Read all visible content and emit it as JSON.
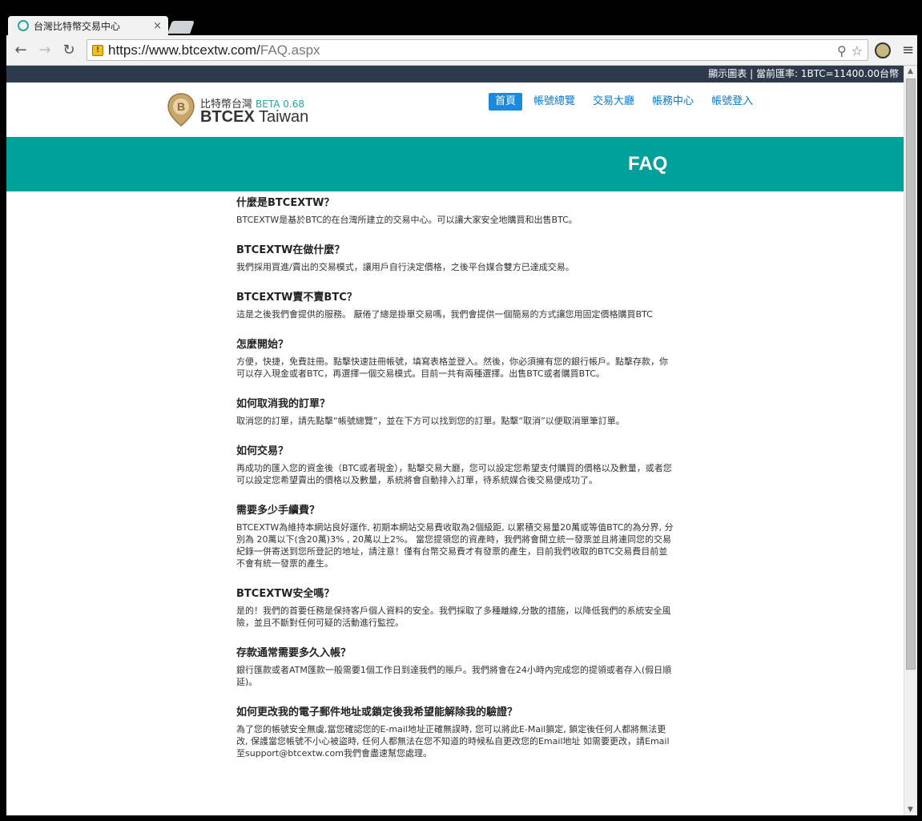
{
  "browser": {
    "tab_title": "台灣比特幣交易中心",
    "tab_close": "×",
    "url_host": "https://www.btcextw.com/",
    "url_path": "FAQ.aspx"
  },
  "topbar": {
    "text": "顯示圖表 | 當前匯率: 1BTC=11400.00台幣"
  },
  "logo": {
    "cn": "比特幣台灣",
    "beta": "BETA 0.68",
    "en_bold": "BTCEX",
    "en_rest": " Taiwan"
  },
  "nav": {
    "items": [
      "首頁",
      "帳號總覽",
      "交易大廳",
      "帳務中心",
      "帳號登入"
    ]
  },
  "hero": {
    "title": "FAQ"
  },
  "faq": [
    {
      "q": "什麼是BTCEXTW？",
      "a": "BTCEXTW是基於BTC的在台灣所建立的交易中心。可以讓大家安全地購買和出售BTC。"
    },
    {
      "q": "BTCEXTW在做什麼？",
      "a": "我們採用買進/賣出的交易模式，讓用戶自行決定價格，之後平台媒合雙方已達成交易。"
    },
    {
      "q": "BTCEXTW賣不賣BTC？",
      "a": "這是之後我們會提供的服務。 厭倦了總是掛單交易嗎，我們會提供一個簡易的方式讓您用固定價格購買BTC"
    },
    {
      "q": "怎麼開始？",
      "a": "方便，快捷，免費註冊。點擊快速註冊帳號，填寫表格並登入。然後，你必須擁有您的銀行帳戶。點擊存款，你可以存入現金或者BTC，再選擇一個交易模式。目前一共有兩種選擇。出售BTC或者購買BTC。"
    },
    {
      "q": "如何取消我的訂單？",
      "a": "取消您的訂單，請先點擊“帳號總覽”，並在下方可以找到您的訂單。點擊“取消”以便取消單筆訂單。"
    },
    {
      "q": "如何交易？",
      "a": "再成功的匯入您的資金後（BTC或者現金），點擊交易大廳，您可以設定您希望支付購買的價格以及數量，或者您可以設定您希望賣出的價格以及數量，系統將會自動排入訂單，待系統媒合後交易便成功了。"
    },
    {
      "q": "需要多少手續費？",
      "a": "BTCEXTW為維持本網站良好運作, 初期本網站交易費收取為2個級距, 以累積交易量20萬或等值BTC的為分界, 分別為 20萬以下(含20萬)3% , 20萬以上2%。 當您提領您的資產時，我們將會開立統一發票並且將連同您的交易紀錄一併寄送到您所登記的地址，請注意！僅有台幣交易費才有發票的產生，目前我們收取的BTC交易費目前並不會有統一發票的產生。"
    },
    {
      "q": "BTCEXTW安全嗎？",
      "a": "是的！我們的首要任務是保持客戶個人資料的安全。我們採取了多種離線,分散的措施，以降低我們的系統安全風險，並且不斷對任何可疑的活動進行監控。"
    },
    {
      "q": "存款通常需要多久入帳？",
      "a": "銀行匯款或者ATM匯款一般需要1個工作日到達我們的賬戶。我們將會在24小時內完成您的提領或者存入(假日順延)。"
    },
    {
      "q": "如何更改我的電子郵件地址或鎖定後我希望能解除我的驗證？",
      "a": "為了您的帳號安全無虞,當您確認您的E-mail地址正確無誤時, 您可以將此E-Mail鎖定, 鎖定後任何人都將無法更改, 保護當您帳號不小心被盜時, 任何人都無法在您不知道的時候私自更改您的Email地址 如需要更改，請Email至support@btcextw.com我們會盡速幫您處理。"
    }
  ]
}
